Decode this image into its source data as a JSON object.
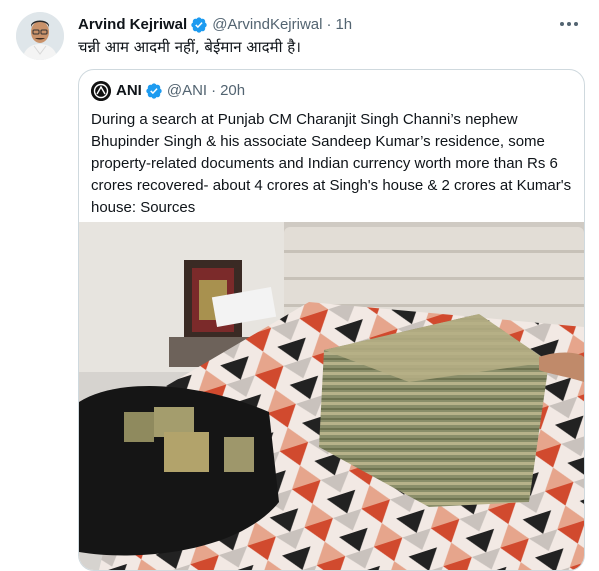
{
  "tweet": {
    "author_name": "Arvind Kejriwal",
    "author_handle": "@ArvindKejriwal",
    "separator": "·",
    "time": "1h",
    "text": "चन्नी आम आदमी नहीं, बेईमान आदमी है।"
  },
  "quoted": {
    "author_name": "ANI",
    "author_handle": "@ANI",
    "separator": "·",
    "time": "20h",
    "text": "During a search at Punjab CM Charanjit Singh Channi’s nephew Bhupinder Singh & his associate Sandeep Kumar’s residence, some property-related documents and Indian currency worth more than Rs 6 crores recovered- about 4 crores at Singh's house & 2 crores at Kumar's house: Sources"
  },
  "icons": {
    "verified": "verified-badge-icon",
    "more": "more-options-icon"
  },
  "colors": {
    "verified_blue": "#1d9bf0",
    "secondary_text": "#536471",
    "border": "#cfd9de"
  }
}
